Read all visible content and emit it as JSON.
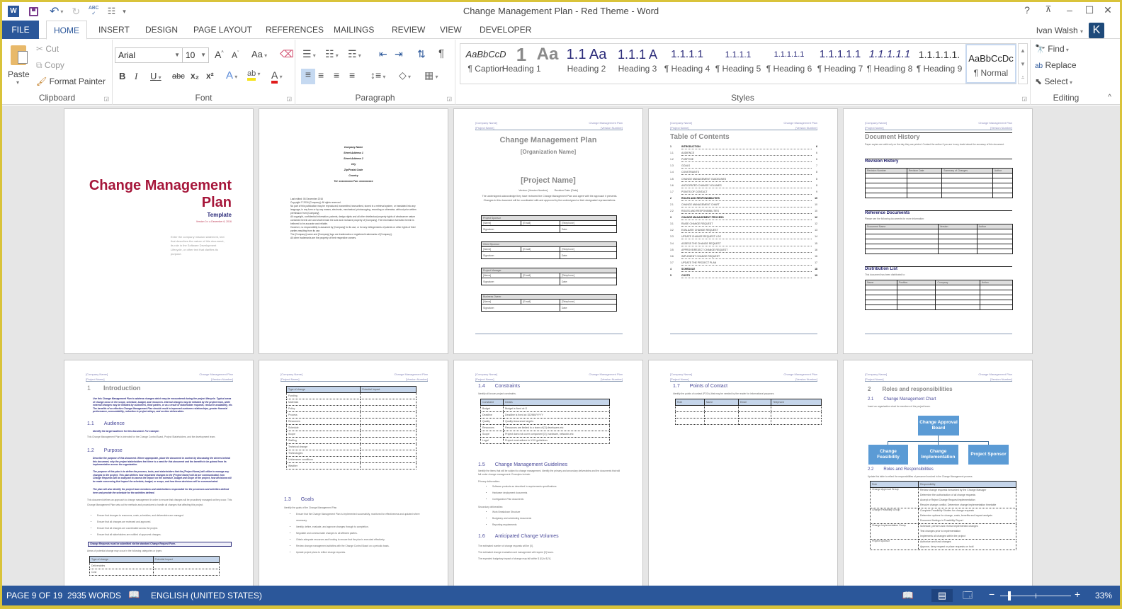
{
  "window": {
    "title": "Change Management Plan - Red Theme - Word",
    "help": "?",
    "ribbon_display": "⊼",
    "minimize": "–",
    "maximize": "☐",
    "close": "✕"
  },
  "qat": {
    "word_icon": "W",
    "save_icon": "💾",
    "undo_icon": "↶",
    "redo_icon": "↻",
    "spell_icon": "ABC✓",
    "customize": "▾"
  },
  "tabs": [
    "FILE",
    "HOME",
    "INSERT",
    "DESIGN",
    "PAGE LAYOUT",
    "REFERENCES",
    "MAILINGS",
    "REVIEW",
    "VIEW",
    "DEVELOPER"
  ],
  "active_tab": "HOME",
  "user": {
    "name": "Ivan Walsh",
    "initial": "K"
  },
  "ribbon": {
    "clipboard": {
      "paste": "Paste",
      "cut": "Cut",
      "copy": "Copy",
      "format_painter": "Format Painter",
      "label": "Clipboard"
    },
    "font": {
      "name": "Arial",
      "size": "10",
      "label": "Font",
      "grow": "A˄",
      "shrink": "A˅",
      "case": "Aa",
      "bold": "B",
      "italic": "I",
      "underline": "U",
      "strike": "abc",
      "subscript": "x₂",
      "superscript": "x²",
      "effects": "A",
      "highlight": "ab",
      "color": "A",
      "highlight_color": "#f5e31a",
      "font_color": "#e01b1b"
    },
    "paragraph": {
      "label": "Paragraph"
    },
    "styles": {
      "label": "Styles",
      "items": [
        {
          "preview": "AaBbCcD",
          "name": "¶ Caption"
        },
        {
          "preview": "1",
          "name": "Heading 1"
        },
        {
          "preview": "Aa",
          "name": "Heading 2"
        },
        {
          "preview": "1.1 Aa",
          "name": "Heading 3"
        },
        {
          "preview": "1.1.1 A",
          "name": "¶ Heading 4"
        },
        {
          "preview": "1.1.1.1",
          "name": "¶ Heading 5"
        },
        {
          "preview": "1.1.1.1.1",
          "name": "¶ Heading 6"
        },
        {
          "preview": "1.1.1.1.1",
          "name": "¶ Heading 7"
        },
        {
          "preview": "1.1.1.1.1",
          "name": "¶ Heading 8"
        },
        {
          "preview": "1.1.1.1.1.",
          "name": "¶ Heading 9"
        },
        {
          "preview": "AaBbCcDc",
          "name": "¶ Normal"
        }
      ],
      "selected": "¶ Normal"
    },
    "editing": {
      "find": "Find",
      "replace": "Replace",
      "select": "Select",
      "label": "Editing"
    }
  },
  "pages": {
    "header": {
      "company": "[Company Name]",
      "project": "[Project Name]",
      "doc": "Change Management Plan",
      "version": "[Version Number]"
    },
    "cover": {
      "title_line1": "Change Management",
      "title_line2": "Plan",
      "subtitle": "Template",
      "version": "Version 0.x ● December 6, 2016",
      "blurb": "Enter the company mission statement, text that describes the nature of this document, its role in the Software Development Lifecycle, or other text that clarifies its purpose."
    },
    "copyright": {
      "address": [
        "Company Name",
        "Street Address 1",
        "Street Address 2",
        "City",
        "Zip/Postal Code",
        "Country",
        "Tel: xxxxxxxxxx Fax: xxxxxxxxxx"
      ],
      "lines": [
        "Last edited: 06 December 2016",
        "Copyright © 2016 [Company]. All rights reserved.",
        "No part of this publication may be reproduced, transmitted, transcribed, stored in a retrieval system, or translated into any language, in any form or by any means, electronic, mechanical, photocopying, recording or otherwise, without prior written permission from [Company].",
        "All copyright, confidential information, patents, design rights and all other intellectual property rights of whatsoever nature contained herein are and shall remain the sole and exclusive property of [Company]. The information furnished herein is believed to be accurate and reliable.",
        "However, no responsibility is assumed by [Company] for its use, or for any infringements of patents or other rights of third parties resulting from its use.",
        "The [Company] name and [Company] logo are trademarks or registered trademarks of [Company].",
        "All other trademarks are the property of their respective owners."
      ]
    },
    "signoff": {
      "title": "Change Management Plan",
      "org": "[Organization Name]",
      "project": "[Project Name]",
      "version_line": "Version: [Version Number]          Revision Date: [Date]",
      "intro": "The undersigned acknowledge they have reviewed the Change Management Plan and agree with the approach it presents. Changes to this document will be coordinated with and approved by the undersigned or their designated representatives.",
      "blocks": [
        "Project Sponsor",
        "Client Sponsor",
        "Project Manager",
        "Business Owner"
      ],
      "fields": [
        "[Name]",
        "[Email]",
        "[Telephone]",
        "Signature:",
        "Date:"
      ]
    },
    "toc": {
      "title": "Table of Contents",
      "rows": [
        {
          "n": "1",
          "t": "INTRODUCTION",
          "p": "6",
          "b": true
        },
        {
          "n": "1.1",
          "t": "AUDIENCE",
          "p": "6",
          "b": false
        },
        {
          "n": "1.2",
          "t": "PURPOSE",
          "p": "6",
          "b": false
        },
        {
          "n": "1.3",
          "t": "GOALS",
          "p": "7",
          "b": false
        },
        {
          "n": "1.4",
          "t": "CONSTRAINTS",
          "p": "8",
          "b": false
        },
        {
          "n": "1.5",
          "t": "CHANGE MANAGEMENT GUIDELINES",
          "p": "8",
          "b": false
        },
        {
          "n": "1.6",
          "t": "ANTICIPATED CHANGE VOLUMES",
          "p": "8",
          "b": false
        },
        {
          "n": "1.7",
          "t": "POINTS OF CONTACT",
          "p": "9",
          "b": false
        },
        {
          "n": "2",
          "t": "ROLES AND RESPONSIBILITIES",
          "p": "10",
          "b": true
        },
        {
          "n": "2.1",
          "t": "CHANGE MANAGEMENT CHART",
          "p": "10",
          "b": false
        },
        {
          "n": "2.2",
          "t": "ROLES AND RESPONSIBILITIES",
          "p": "10",
          "b": false
        },
        {
          "n": "3",
          "t": "CHANGE MANAGEMENT PROCESS",
          "p": "12",
          "b": true
        },
        {
          "n": "3.1",
          "t": "RAISE CHANGE REQUEST",
          "p": "12",
          "b": false
        },
        {
          "n": "3.2",
          "t": "EVALUATE CHANGE REQUEST",
          "p": "13",
          "b": false
        },
        {
          "n": "3.3",
          "t": "UPDATE CHANGE REQUEST LOG",
          "p": "14",
          "b": false
        },
        {
          "n": "3.4",
          "t": "ASSESS THE CHANGE REQUEST",
          "p": "15",
          "b": false
        },
        {
          "n": "3.5",
          "t": "APPROVE/REJECT CHANGE REQUEST",
          "p": "16",
          "b": false
        },
        {
          "n": "3.6",
          "t": "IMPLEMENT CHANGE REQUEST",
          "p": "16",
          "b": false
        },
        {
          "n": "3.7",
          "t": "UPDATE THE PROJECT PLAN",
          "p": "17",
          "b": false
        },
        {
          "n": "4",
          "t": "SCHEDULE",
          "p": "18",
          "b": true
        },
        {
          "n": "5",
          "t": "COSTS",
          "p": "19",
          "b": true
        }
      ]
    },
    "history": {
      "title": "Document History",
      "intro": "Paper copies are valid only on the day they are printed. Contact the author if you are in any doubt about the accuracy of this document.",
      "revision_title": "Revision History",
      "revision_cols": [
        "Revision Number",
        "Revision Date",
        "Summary of Changes",
        "Author"
      ],
      "reference_title": "Reference Documents",
      "reference_intro": "Please see the following documents for more information:",
      "reference_cols": [
        "Document Name",
        "Version",
        "Author"
      ],
      "distribution_title": "Distribution List",
      "distribution_intro": "This document has been distributed to:",
      "distribution_cols": [
        "Name",
        "Position",
        "Company",
        "Action"
      ]
    },
    "intro": {
      "h1_num": "1",
      "h1": "Introduction",
      "intro_text": "Use this Change Management Plan to address changes which may be encountered during the project lifecycle. Typical areas of change occur in the scope, schedule, budget, and resources. Internal changes may be initiated by the project team, while external changes may be initiated by customers, third parties, or as a result of stakeholder requests, resource availability, etc. The benefits of an effective Change Management Plan should result in improved customer relationships, greater financial performance, accountability, reduction in project delays, and on-time deliverables.",
      "h2a_num": "1.1",
      "h2a": "Audience",
      "aud_ital": "Identify the target audience for this document. For example:",
      "aud_text": "This Change Management Plan is intended for the Change Control Board, Project Stakeholders, and the development team.",
      "h2b_num": "1.2",
      "h2b": "Purpose",
      "purpose_ital": "Describe the purpose of this document. Where appropriate, place the document in context by discussing the drivers behind this document, why the project stakeholders feel there is a need for this document and the benefits to be gained from its implementation across the organization.",
      "purpose_ital2": "The purpose of this plan is to define the process, tools, and stakeholders that the [Project Name] will utilize to manage any changes to the project. This plan defines how requested changes to the [Project Name] will be are communicated, how Change Requests will be analyzed to assess the impact on the schedule, budget and scope of the project, how decisions will be made concerning that impact the schedule, budget, or scope, and how these decisions will be communicated.",
      "purpose_ital3": "The plan will also identify the project team members and stakeholders responsible for the processes and activities defined here and provide the schedule for the activities defined.",
      "purpose_text": "This document defines an approach to change management in order to ensure that changes will be proactively managed as they occur. This Change Management Plan sets out the methods and procedures to handle all changes that affecting this project.",
      "bullets": [
        "Ensure that changes to resources, costs, schedules, and deliverables are managed.",
        "Ensure that all changes are reviewed and approved.",
        "Ensure that all changes are coordinated across the project.",
        "Ensure that all stakeholders are notified of approved changes."
      ],
      "callout": "Change Requests must be submitted via the standard Change Request Form.",
      "areas_text": "Areas of potential change may occur in the following categories or types:",
      "table_cols": [
        "Type of change",
        "Potential Impact"
      ],
      "table_rows": [
        "Deliverables",
        "Cost"
      ]
    },
    "changes": {
      "table_cols": [
        "Type of change",
        "Potential Impact"
      ],
      "table_rows": [
        "Funding",
        "Materials",
        "Policy",
        "Process",
        "Resources",
        "Schedule",
        "Scope",
        "Staffing",
        "Technical change",
        "Technologies",
        "Unforeseen conditions",
        "Weather"
      ],
      "h2_num": "1.3",
      "h2": "Goals",
      "goals_intro": "Identify the goals of the Change Management Plan.",
      "goals": [
        "Ensure that the Change Management Plan is implemented successfully, monitored for effectiveness and updated where necessary.",
        "Identify, define, evaluate, and approve changes through to completion.",
        "Negotiate and communicate changes to all affected parties.",
        "Obtain adequate resources and funding to ensure that the plan is executed effectively.",
        "Review change management activities with the Change Control Board on a periodic basis.",
        "Update project plans to reflect change requests."
      ]
    },
    "constraints": {
      "h2_num": "1.4",
      "h2": "Constraints",
      "intro": "Identify all known project constraints.",
      "table_cols": [
        "Constraint",
        "Details"
      ],
      "table_rows": [
        [
          "Budget",
          "Budget is fixed at: $"
        ],
        [
          "Deadline",
          "Deadline is fixed at: DD/MM/YYYY"
        ],
        [
          "Quality",
          "Quality Assurance targets"
        ],
        [
          "Resources",
          "Resources are limited to a team of [X] developers etc"
        ],
        [
          "Scope",
          "Project does not cover component [X], hardware, networks etc"
        ],
        [
          "Legal",
          "Project must adhere to XXX guidelines"
        ]
      ],
      "h2b_num": "1.5",
      "h2b": "Change Management Guidelines",
      "guide_text": "Identify the items that will be subject to change management. Identify the primary and secondary deliverables and the documents that will fall under change management. Examples include:",
      "primary_label": "Primary deliverables:",
      "primary": [
        "Software products as described in requirements specifications",
        "Hardware deployment documents",
        "Configuration Plan documents"
      ],
      "secondary_label": "Secondary deliverables:",
      "secondary": [
        "Work Breakdown Structure",
        "Budgetary and scheduling documents",
        "Reporting requirements"
      ],
      "h2c_num": "1.6",
      "h2c": "Anticipated Change Volumes",
      "volumes": [
        "The estimated number of change requests will be [X].",
        "The estimated change evaluation and management will require [X] hours.",
        "The expected budgetary impact of change may fall within $ [X] to $ [Y]."
      ]
    },
    "contacts": {
      "h2_num": "1.7",
      "h2": "Points of Contact",
      "intro": "Identify the points of contact (POCs) that may be needed by the reader for informational purposes.",
      "table_cols": [
        "Role",
        "Name",
        "Email",
        "Telephone"
      ]
    },
    "roles": {
      "h1_num": "2",
      "h1": "Roles and responsibilities",
      "h2a_num": "2.1",
      "h2a": "Change Management Chart",
      "chart_intro": "Insert an organization chart for members of the project team.",
      "org_top": "Change Approval Board",
      "org_children": [
        "Change Feasibility",
        "Change Implementation",
        "Project Sponsor"
      ],
      "h2b_num": "2.2",
      "h2b": "Roles and Responsibilities",
      "table_intro": "Update this table to reflect the responsibilities of personnel involved in the Change Management process.",
      "table_cols": [
        "Role",
        "Responsibility"
      ],
      "table_rows": [
        {
          "role": "Change Approval Group",
          "items": [
            "Review change requests forwarded by the Change Manager",
            "Determine the authorization of all change requests",
            "Accept or Reject Change Request implementation",
            "Resolve change conflict. Determine change implementation timetable"
          ]
        },
        {
          "role": "Change Feasibility Group",
          "items": [
            "Complete Feasibility Studies for change requests",
            "Determine options for change, costs, benefits and impact analysis",
            "Document findings in Feasibility Report"
          ]
        },
        {
          "role": "Change Implementation Group",
          "items": [
            "Schedule, perform and review implemented changes",
            "Test changes prior to implementation",
            "Implements all changes within the project"
          ]
        },
        {
          "role": "Project Sponsor",
          "items": [
            "Authorize and fund changes",
            "Approve, deny request or place requests on hold"
          ]
        }
      ]
    }
  },
  "status": {
    "page": "PAGE 9 OF 19",
    "words": "2935 WORDS",
    "language": "ENGLISH (UNITED STATES)",
    "zoom": "33%",
    "zoom_fraction": 0.33
  }
}
